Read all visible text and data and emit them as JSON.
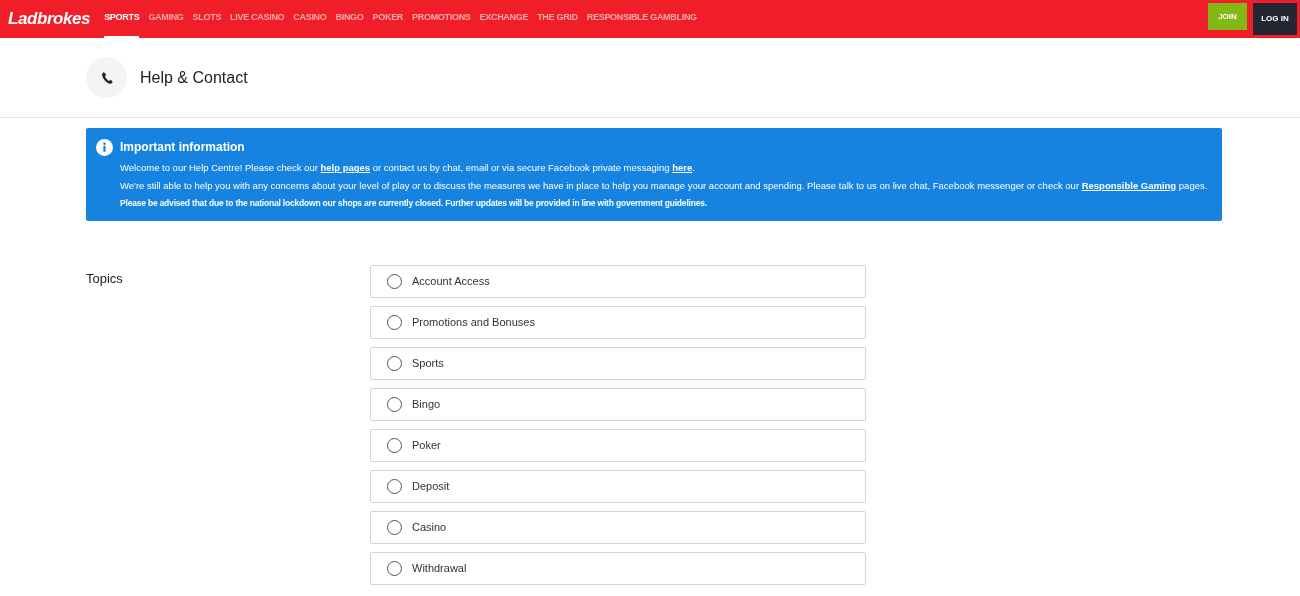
{
  "header": {
    "logo": "Ladbrokes",
    "nav": [
      {
        "label": "SPORTS",
        "selected": true
      },
      {
        "label": "GAMING",
        "selected": false
      },
      {
        "label": "SLOTS",
        "selected": false
      },
      {
        "label": "LIVE CASINO",
        "selected": false
      },
      {
        "label": "CASINO",
        "selected": false
      },
      {
        "label": "BINGO",
        "selected": false
      },
      {
        "label": "POKER",
        "selected": false
      },
      {
        "label": "PROMOTIONS",
        "selected": false
      },
      {
        "label": "EXCHANGE",
        "selected": false
      },
      {
        "label": "THE GRID",
        "selected": false
      },
      {
        "label": "RESPONSIBLE GAMBLING",
        "selected": false
      }
    ],
    "join": "JOIN",
    "login": "LOG IN"
  },
  "page_title": "Help & Contact",
  "notice": {
    "title": "Important information",
    "paragraphs": [
      {
        "before": "Welcome to our Help Centre! Please check our ",
        "link": "help pages",
        "middle": " or contact us by chat, email or via secure Facebook private messaging ",
        "link2": "here",
        "after": "."
      },
      {
        "before": "We're still able to help you with any concerns about your level of play or to discuss the measures we have in place to help you manage your account and spending. Please talk to us on live chat, Facebook messenger or check our ",
        "link": "Responsible Gaming",
        "after": " pages."
      }
    ],
    "bold_line": "Please be advised that due to the national lockdown our shops are currently closed. Further updates will be provided in line with government guidelines."
  },
  "topics": {
    "label": "Topics",
    "options": [
      {
        "label": "Account Access",
        "selected": false
      },
      {
        "label": "Promotions and Bonuses",
        "selected": false
      },
      {
        "label": "Sports",
        "selected": false
      },
      {
        "label": "Bingo",
        "selected": false
      },
      {
        "label": "Poker",
        "selected": false
      },
      {
        "label": "Deposit",
        "selected": false
      },
      {
        "label": "Casino",
        "selected": false
      },
      {
        "label": "Withdrawal",
        "selected": false
      }
    ]
  }
}
